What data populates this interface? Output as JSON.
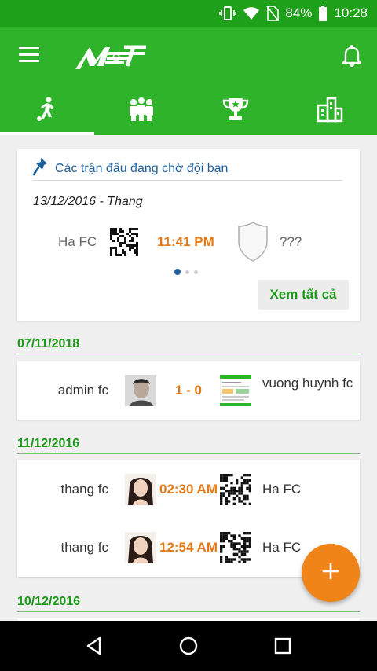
{
  "status_bar": {
    "battery_percent": "84%",
    "time": "10:28",
    "icons": [
      "vibrate-icon",
      "wifi-icon",
      "no-sim-icon",
      "battery-icon"
    ]
  },
  "app_bar": {
    "logo_text": "MET",
    "icons": [
      "menu-icon",
      "bell-icon"
    ]
  },
  "tabs": [
    {
      "name": "soccer-player-icon",
      "active": true
    },
    {
      "name": "team-icon",
      "active": false
    },
    {
      "name": "trophy-icon",
      "active": false
    },
    {
      "name": "buildings-icon",
      "active": false
    }
  ],
  "pending": {
    "header": "Các trận đấu đang chờ đội bạn",
    "date_label": "13/12/2016 - Thang",
    "team1": "Ha FC",
    "time": "11:41 PM",
    "team2": "???",
    "page_count": 3,
    "active_page": 1,
    "view_all_label": "Xem tất cả"
  },
  "groups": [
    {
      "date": "07/11/2018",
      "matches": [
        {
          "team1": "admin fc",
          "center": "1 - 0",
          "team2": "vuong huynh fc"
        }
      ]
    },
    {
      "date": "11/12/2016",
      "matches": [
        {
          "team1": "thang fc",
          "center": "02:30 AM",
          "team2": "Ha FC"
        },
        {
          "team1": "thang fc",
          "center": "12:54 AM",
          "team2": "Ha FC"
        }
      ]
    },
    {
      "date": "10/12/2016",
      "matches": []
    }
  ],
  "colors": {
    "primary": "#2eb32a",
    "status_bar": "#1fa01a",
    "accent": "#f08419",
    "time_text": "#e37814",
    "link_blue": "#1d5f9c"
  }
}
